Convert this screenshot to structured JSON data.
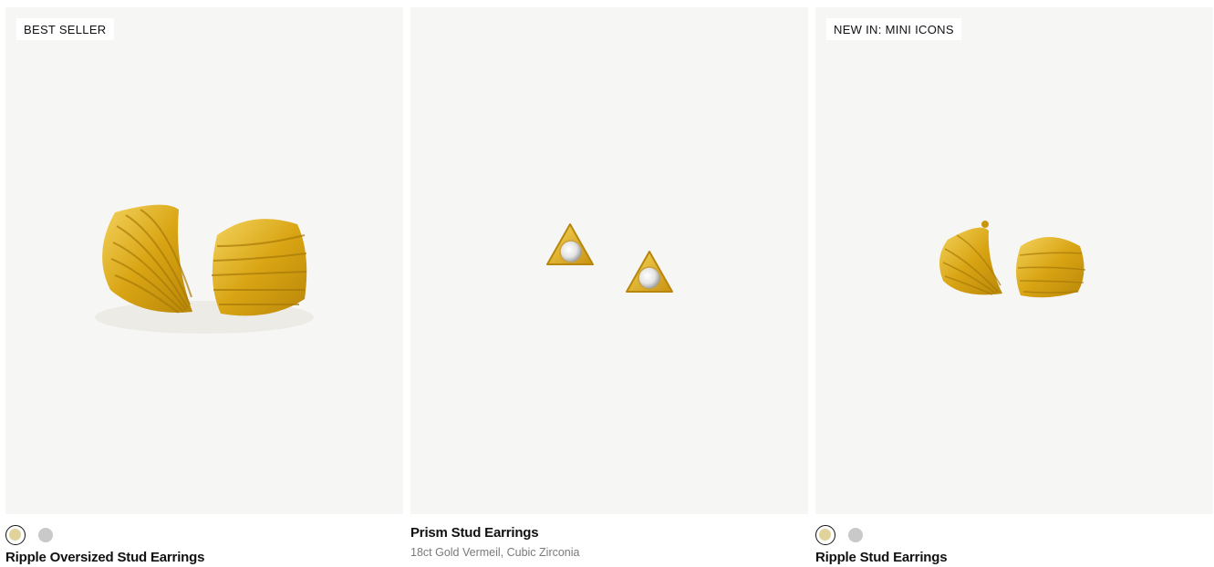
{
  "products": [
    {
      "badge": "BEST SELLER",
      "name": "Ripple Oversized Stud Earrings",
      "swatches": [
        "gold",
        "silver"
      ]
    },
    {
      "badge": "",
      "name": "Prism Stud Earrings",
      "subtitle": "18ct Gold Vermeil, Cubic Zirconia"
    },
    {
      "badge": "NEW IN: MINI ICONS",
      "name": "Ripple Stud Earrings",
      "swatches": [
        "gold",
        "silver"
      ]
    }
  ],
  "colors": {
    "image_bg": "#f6f6f4",
    "gold_swatch": "#e0d29a",
    "silver_swatch": "#c9c9c9",
    "gold_metal": "#e3b52a"
  }
}
